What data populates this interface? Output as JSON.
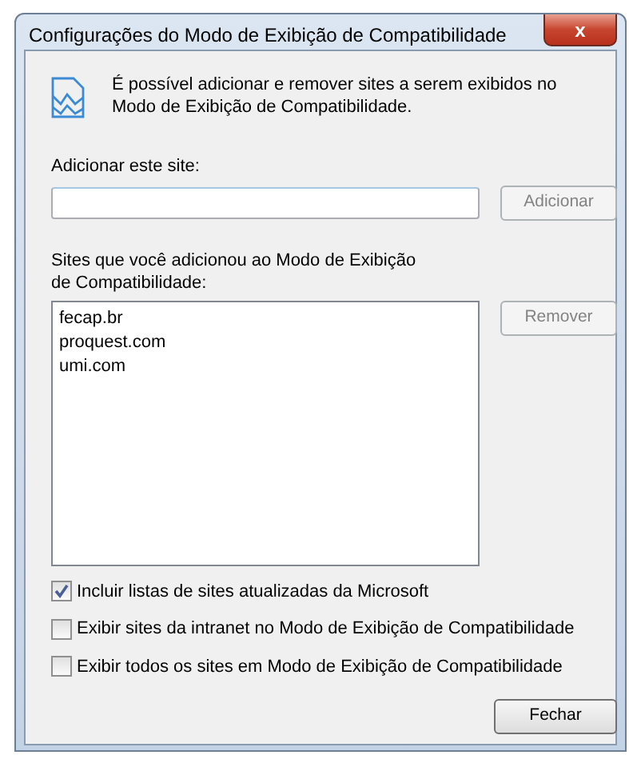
{
  "window": {
    "title": "Configurações do Modo de Exibição de Compatibilidade",
    "close_button": "x"
  },
  "intro": "É possível adicionar e remover sites a serem exibidos no Modo de Exibição de Compatibilidade.",
  "add_site": {
    "label": "Adicionar este site:",
    "button": {
      "label": "Adicionar",
      "disabled": true
    }
  },
  "sites_list": {
    "label": "Sites que você adicionou ao Modo de Exibição de Compatibilidade:",
    "items": [
      "fecap.br",
      "proquest.com",
      "umi.com"
    ],
    "button": {
      "label": "Remover",
      "disabled": true
    }
  },
  "options": [
    {
      "label": "Incluir listas de sites atualizadas da Microsoft",
      "checked": true
    },
    {
      "label": "Exibir sites da intranet no Modo de Exibição de Compatibilidade",
      "checked": false
    },
    {
      "label": "Exibir todos os sites em Modo de Exibição de Compatibilidade",
      "checked": false
    }
  ],
  "buttons": [
    {
      "label": "Fechar"
    }
  ]
}
